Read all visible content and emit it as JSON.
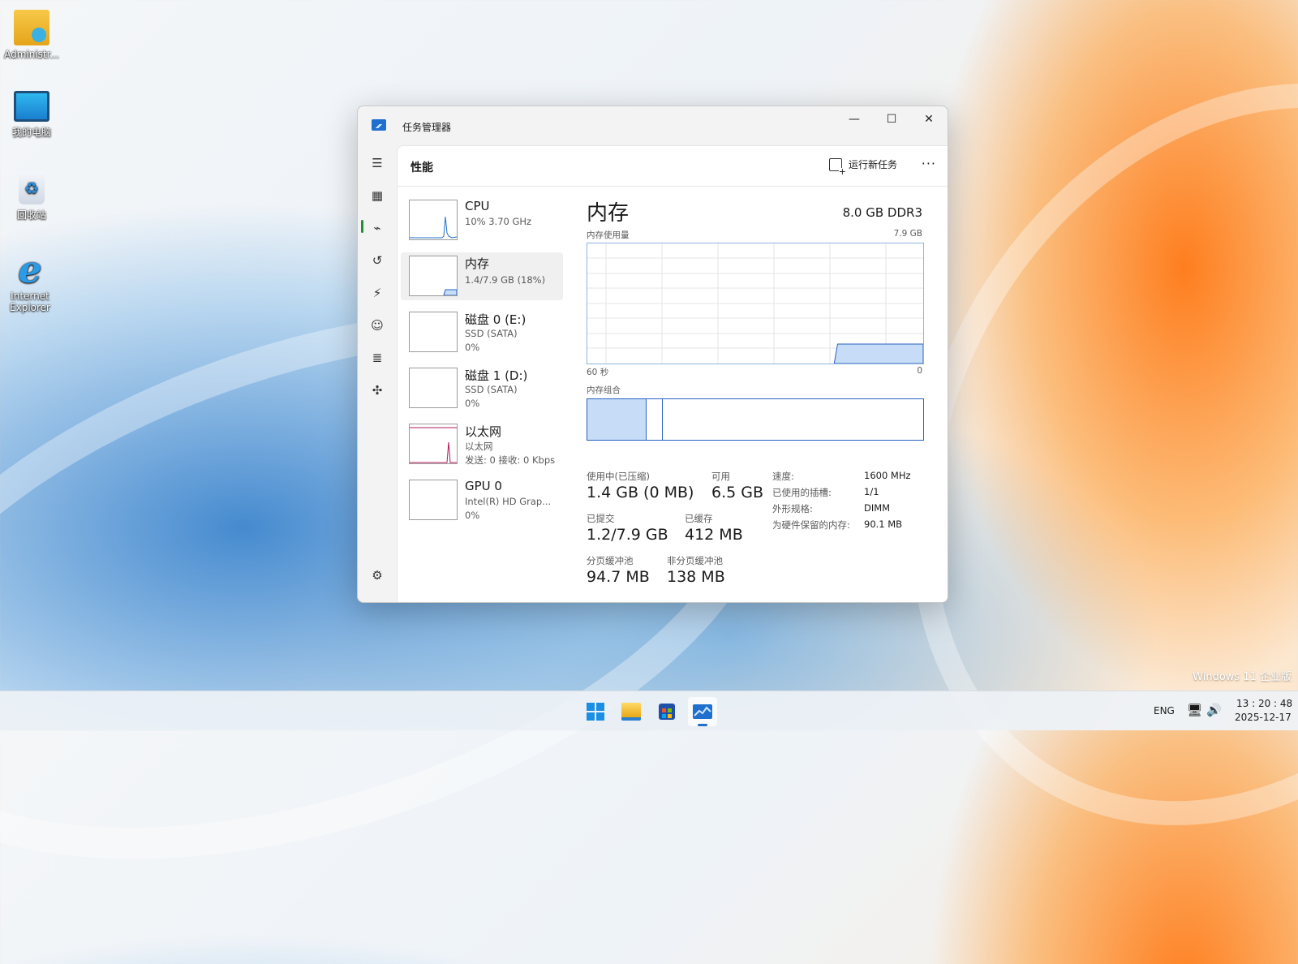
{
  "desktop": {
    "icons": [
      {
        "label": "Administr..."
      },
      {
        "label": "我的电脑"
      },
      {
        "label": "回收站"
      },
      {
        "label": "Internet Explorer"
      }
    ],
    "watermark": "Windows 11 企业版"
  },
  "window": {
    "title": "任务管理器",
    "controls": {
      "minimize": "—",
      "maximize": "☐",
      "close": "✕"
    }
  },
  "header": {
    "page_title": "性能",
    "run_task_label": "运行新任务",
    "more": "···"
  },
  "devices": [
    {
      "name": "CPU",
      "line1": "10%  3.70 GHz",
      "line2": ""
    },
    {
      "name": "内存",
      "line1": "1.4/7.9 GB (18%)",
      "line2": ""
    },
    {
      "name": "磁盘 0 (E:)",
      "line1": "SSD (SATA)",
      "line2": "0%"
    },
    {
      "name": "磁盘 1 (D:)",
      "line1": "SSD (SATA)",
      "line2": "0%"
    },
    {
      "name": "以太网",
      "line1": "以太网",
      "line2": "发送: 0 接收: 0 Kbps"
    },
    {
      "name": "GPU 0",
      "line1": "Intel(R) HD Grap...",
      "line2": "0%"
    }
  ],
  "memory": {
    "title": "内存",
    "spec": "8.0 GB DDR3",
    "usage_label": "内存使用量",
    "usage_max": "7.9 GB",
    "axis_left": "60 秒",
    "axis_right": "0",
    "composition_label": "内存组合",
    "usage_fraction": 0.18,
    "stats": {
      "in_use_label": "使用中(已压缩)",
      "in_use_value": "1.4 GB (0 MB)",
      "available_label": "可用",
      "available_value": "6.5 GB",
      "committed_label": "已提交",
      "committed_value": "1.2/7.9 GB",
      "cached_label": "已缓存",
      "cached_value": "412 MB",
      "paged_label": "分页缓冲池",
      "paged_value": "94.7 MB",
      "nonpaged_label": "非分页缓冲池",
      "nonpaged_value": "138 MB"
    },
    "specs": [
      {
        "key": "速度:",
        "value": "1600 MHz"
      },
      {
        "key": "已使用的插槽:",
        "value": "1/1"
      },
      {
        "key": "外形规格:",
        "value": "DIMM"
      },
      {
        "key": "为硬件保留的内存:",
        "value": "90.1 MB"
      }
    ]
  },
  "taskbar": {
    "lang": "ENG",
    "time": "13 : 20 : 48",
    "date": "2025-12-17"
  },
  "colors": {
    "accent": "#1f6fcc",
    "memory_fill": "#c7dcf6",
    "memory_line": "#2a62c4",
    "ethernet_line": "#b0195a",
    "nav_indicator": "#1f8f3a"
  }
}
